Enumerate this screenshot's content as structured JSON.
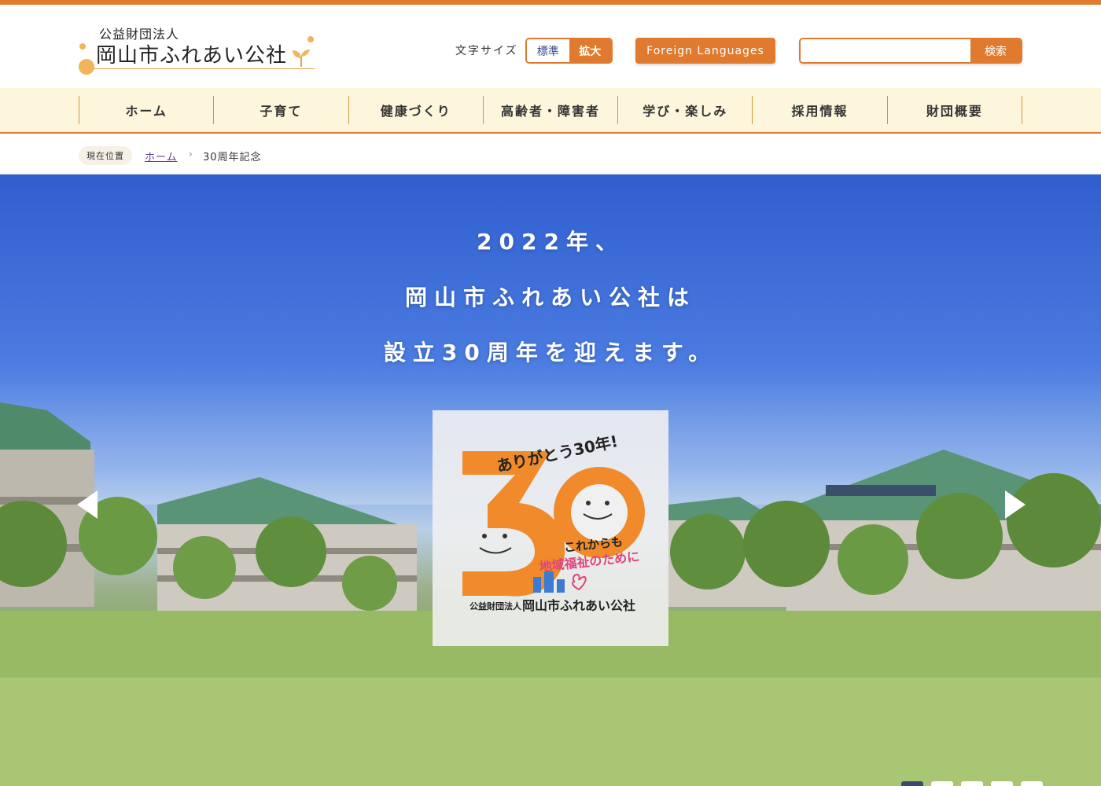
{
  "header": {
    "logo_sub": "公益財団法人",
    "logo_main": "岡山市ふれあい公社",
    "fontsize_label": "文字サイズ",
    "fontsize_standard": "標準",
    "fontsize_large": "拡大",
    "foreign_label": "Foreign Languages",
    "search_placeholder": "",
    "search_button": "検索"
  },
  "nav": {
    "items": [
      {
        "label": "ホーム"
      },
      {
        "label": "子育て"
      },
      {
        "label": "健康づくり"
      },
      {
        "label": "高齢者・障害者"
      },
      {
        "label": "学び・楽しみ"
      },
      {
        "label": "採用情報"
      },
      {
        "label": "財団概要"
      }
    ]
  },
  "breadcrumb": {
    "label": "現在位置",
    "home": "ホーム",
    "separator": "›",
    "current": "30周年記念"
  },
  "hero": {
    "line1": "2022年、",
    "line2": "岡山市ふれあい公社は",
    "line3": "設立30周年を迎えます。",
    "badge": {
      "number": "30",
      "arc_text": "ありがとう30年!",
      "sub_text1": "これからも",
      "sub_text2": "地域福祉のために",
      "org_small": "公益財団法人",
      "org_name": "岡山市ふれあい公社"
    },
    "slides_total": 5,
    "slides_active": 0
  },
  "colors": {
    "accent": "#e07a2e",
    "nav_bg": "#fdf6dd",
    "link": "#6a3c8a"
  }
}
